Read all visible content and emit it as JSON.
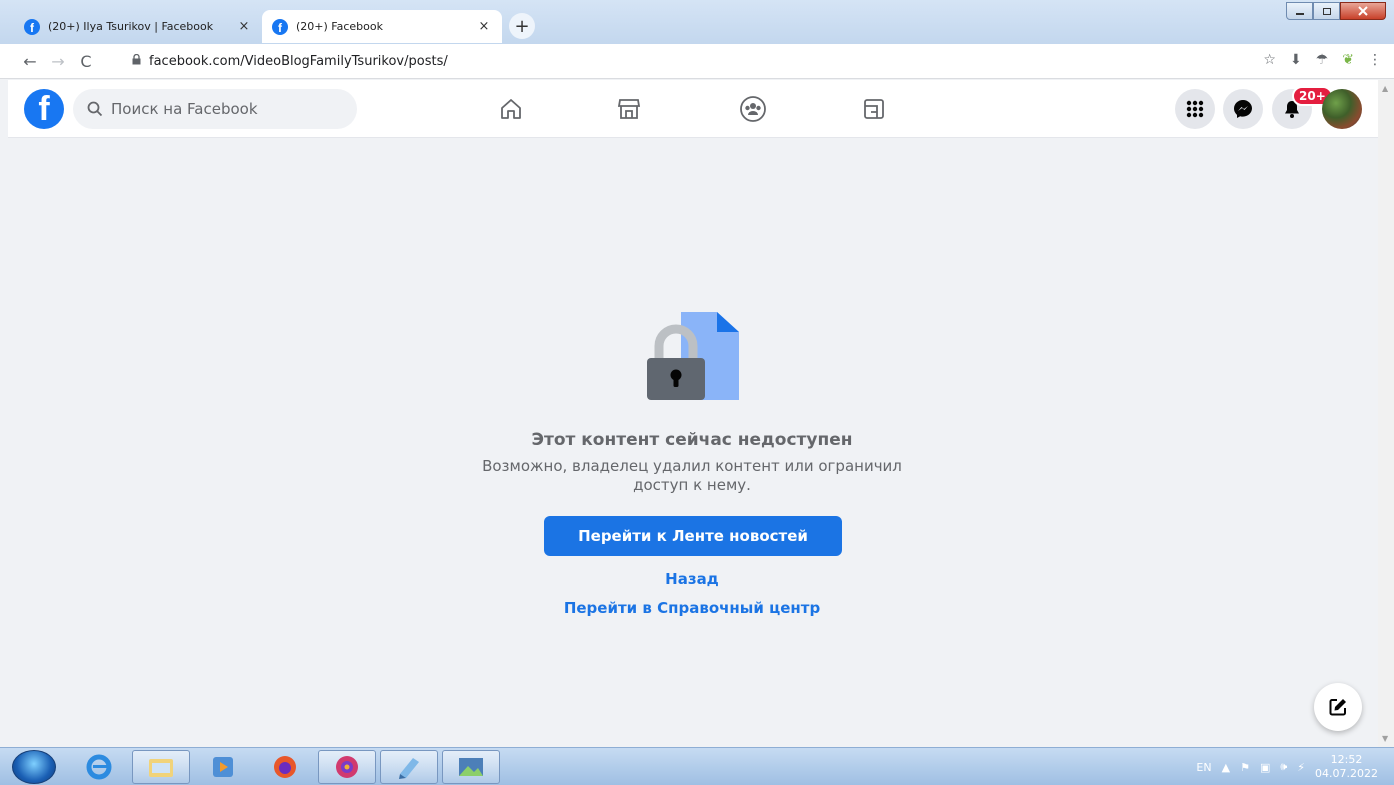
{
  "browser": {
    "tabs": [
      {
        "title": "(20+) Ilya Tsurikov | Facebook",
        "close": "×"
      },
      {
        "title": "(20+) Facebook",
        "close": "×"
      }
    ],
    "new_tab": "+",
    "url": "facebook.com/VideoBlogFamilyTsurikov/posts/"
  },
  "facebook": {
    "search_placeholder": "Поиск на Facebook",
    "notifications_badge": "20+"
  },
  "message": {
    "title": "Этот контент сейчас недоступен",
    "body_line1": "Возможно, владелец удалил контент или ограничил",
    "body_line2": "доступ к нему.",
    "feed_button": "Перейти к Ленте новостей",
    "back_link": "Назад",
    "help_link": "Перейти в Справочный центр"
  },
  "taskbar": {
    "language": "EN",
    "time": "12:52",
    "date": "04.07.2022"
  },
  "colors": {
    "facebook_blue": "#1877f2",
    "button_blue": "#1b74e4",
    "badge_red": "#e41e3f",
    "text_gray": "#65676b"
  },
  "icons": [
    "facebook-favicon",
    "back-arrow",
    "forward-arrow",
    "reload",
    "lock",
    "star",
    "download",
    "umbrella",
    "leaf-extension",
    "menu-dots",
    "search",
    "home",
    "marketplace",
    "groups",
    "gaming",
    "grid-menu",
    "messenger",
    "bell",
    "avatar",
    "compose",
    "windows-start",
    "internet-explorer",
    "explorer",
    "media-player",
    "firefox",
    "app-s",
    "app-notepad",
    "app-photos"
  ]
}
